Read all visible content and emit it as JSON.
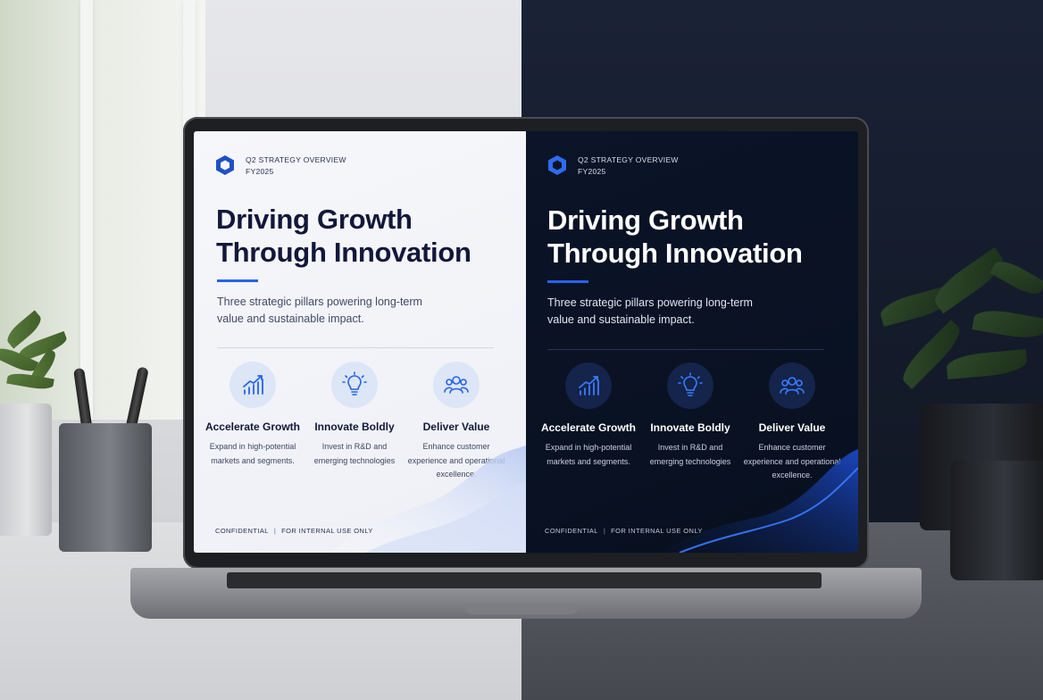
{
  "slides": [
    {
      "theme": "light",
      "header": {
        "line1": "Q2 STRATEGY OVERVIEW",
        "line2": "FY2025",
        "logo_icon": "hexagon-logo-icon"
      },
      "title_line1": "Driving Growth",
      "title_line2": "Through Innovation",
      "subtitle": "Three strategic pillars powering long-term value and sustainable impact.",
      "pillars": [
        {
          "icon": "growth-chart-icon",
          "title": "Accelerate Growth",
          "desc": "Expand in high-potential markets and segments."
        },
        {
          "icon": "lightbulb-icon",
          "title": "Innovate Boldly",
          "desc": "Invest in R&D and emerging technologies"
        },
        {
          "icon": "people-group-icon",
          "title": "Deliver Value",
          "desc": "Enhance customer experience and operational excellence."
        }
      ],
      "footer": {
        "left": "CONFIDENTIAL",
        "separator": "|",
        "right": "FOR INTERNAL USE ONLY"
      }
    },
    {
      "theme": "dark",
      "header": {
        "line1": "Q2 STRATEGY OVERVIEW",
        "line2": "FY2025",
        "logo_icon": "hexagon-logo-icon"
      },
      "title_line1": "Driving Growth",
      "title_line2": "Through Innovation",
      "subtitle": "Three strategic pillars powering long-term value and sustainable impact.",
      "pillars": [
        {
          "icon": "growth-chart-icon",
          "title": "Accelerate Growth",
          "desc": "Expand in high-potential markets and segments."
        },
        {
          "icon": "lightbulb-icon",
          "title": "Innovate Boldly",
          "desc": "Invest in R&D and emerging technologies"
        },
        {
          "icon": "people-group-icon",
          "title": "Deliver Value",
          "desc": "Enhance customer experience and operational excellence."
        }
      ],
      "footer": {
        "left": "CONFIDENTIAL",
        "separator": "|",
        "right": "FOR INTERNAL USE ONLY"
      }
    }
  ],
  "colors": {
    "accent": "#2563eb",
    "light_title": "#12183a",
    "dark_background": "#0b1428",
    "light_background": "#f6f7fa"
  }
}
